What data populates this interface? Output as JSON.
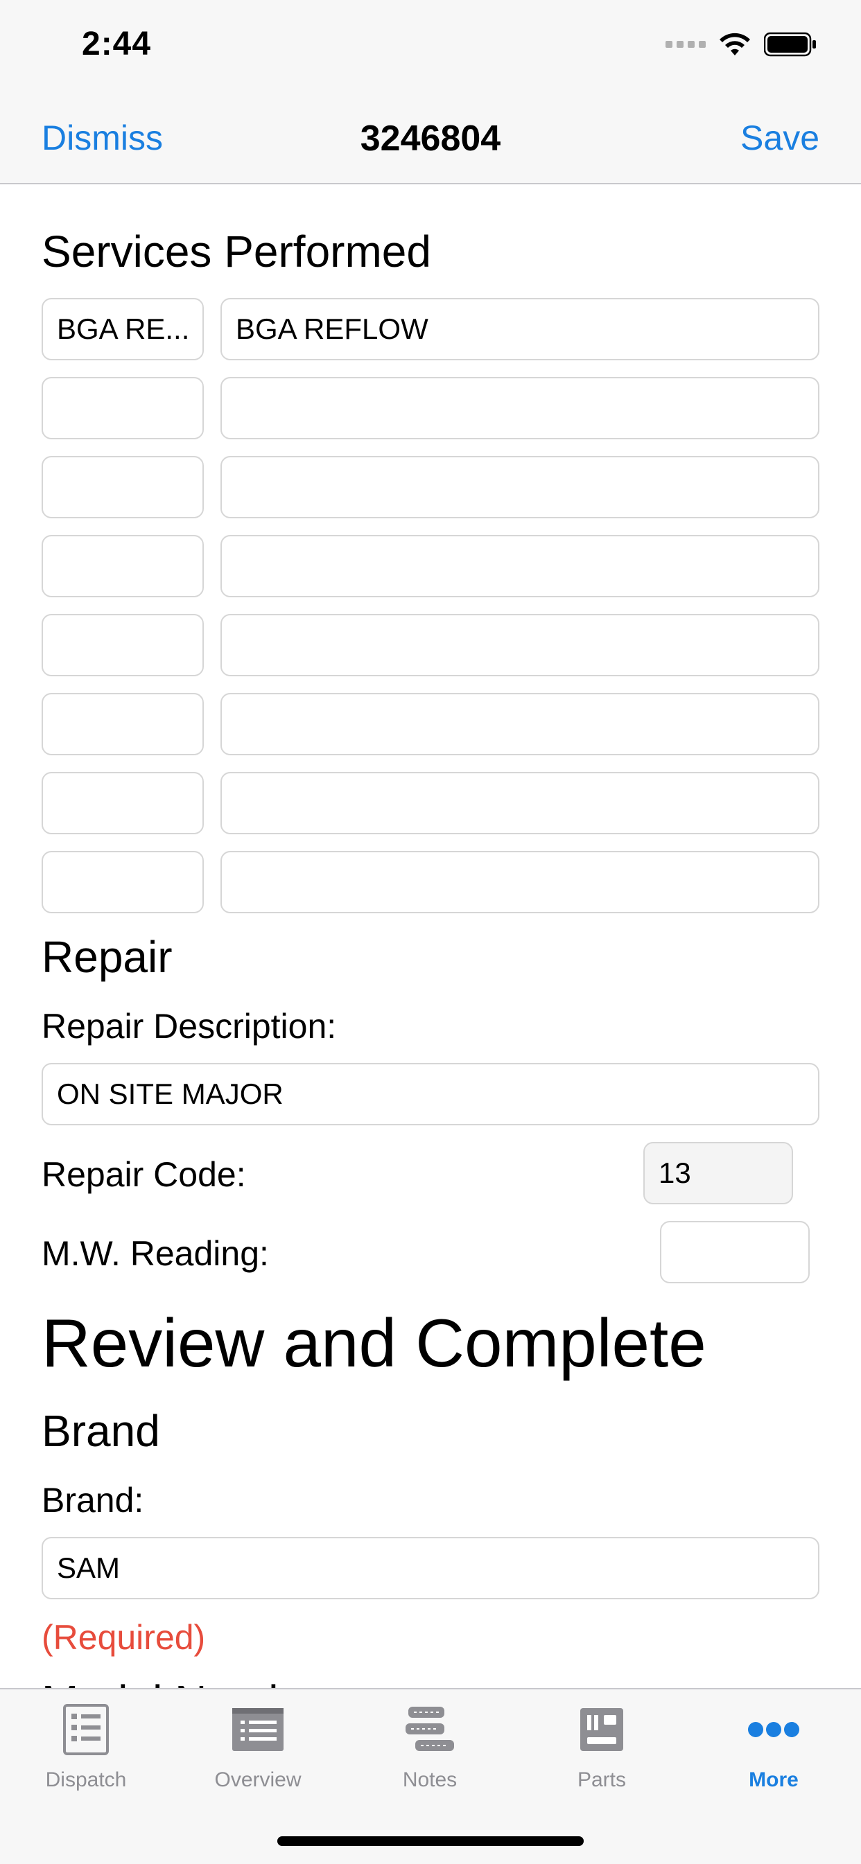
{
  "status_bar": {
    "time": "2:44"
  },
  "nav": {
    "left_button": "Dismiss",
    "title": "3246804",
    "right_button": "Save"
  },
  "services": {
    "title": "Services Performed",
    "rows": [
      {
        "code": "BGA RE...",
        "description": "BGA REFLOW"
      },
      {
        "code": "",
        "description": ""
      },
      {
        "code": "",
        "description": ""
      },
      {
        "code": "",
        "description": ""
      },
      {
        "code": "",
        "description": ""
      },
      {
        "code": "",
        "description": ""
      },
      {
        "code": "",
        "description": ""
      },
      {
        "code": "",
        "description": ""
      }
    ]
  },
  "repair": {
    "title": "Repair",
    "description_label": "Repair Description:",
    "description_value": "ON SITE MAJOR",
    "code_label": "Repair Code:",
    "code_value": "13",
    "mw_label": "M.W. Reading:",
    "mw_value": ""
  },
  "review": {
    "title": "Review and Complete",
    "brand_section": "Brand",
    "brand_label": "Brand:",
    "brand_value": "SAM",
    "required_text": "(Required)",
    "next_section_partial": "Model Number"
  },
  "tabs": [
    {
      "label": "Dispatch",
      "icon": "checklist-icon",
      "active": false
    },
    {
      "label": "Overview",
      "icon": "list-icon",
      "active": false
    },
    {
      "label": "Notes",
      "icon": "notes-icon",
      "active": false
    },
    {
      "label": "Parts",
      "icon": "parts-icon",
      "active": false
    },
    {
      "label": "More",
      "icon": "more-icon",
      "active": true
    }
  ],
  "colors": {
    "accent": "#1a7fe0",
    "required": "#e74c3c",
    "tab_inactive": "#8e8e93"
  }
}
